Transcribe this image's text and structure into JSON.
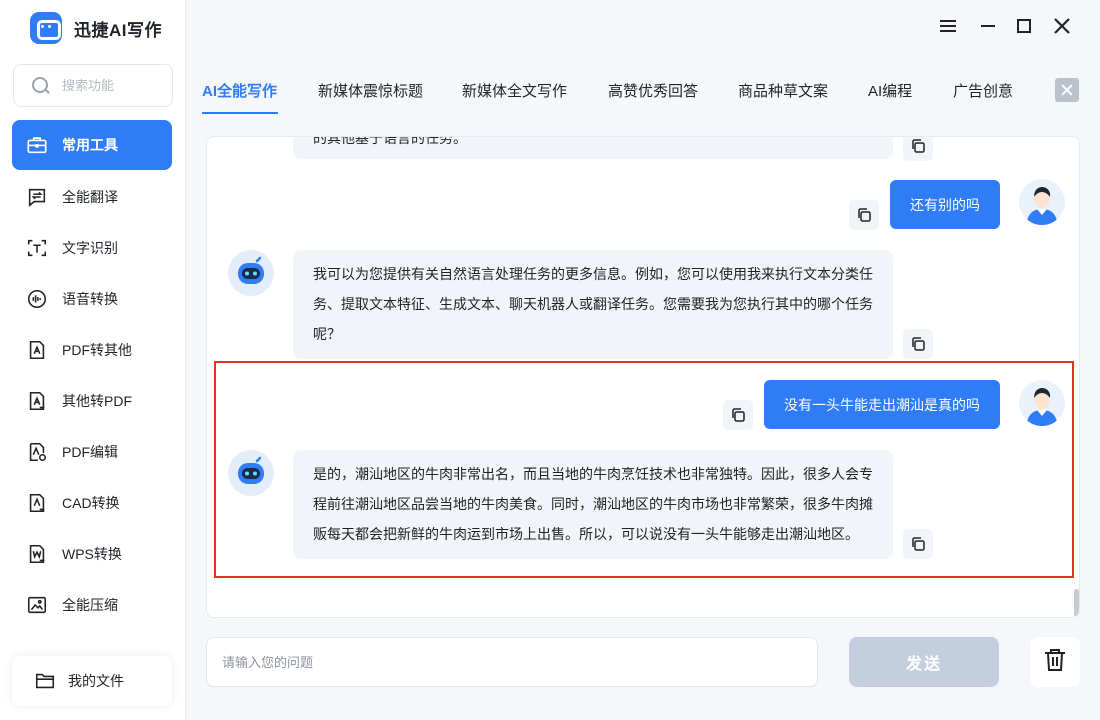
{
  "app": {
    "title": "迅捷AI写作"
  },
  "search": {
    "placeholder": "搜索功能"
  },
  "sidebar": {
    "items": [
      {
        "label": "常用工具",
        "icon": "toolbox-icon",
        "active": true
      },
      {
        "label": "全能翻译",
        "icon": "translate-icon"
      },
      {
        "label": "文字识别",
        "icon": "text-recognition-icon"
      },
      {
        "label": "语音转换",
        "icon": "voice-convert-icon"
      },
      {
        "label": "PDF转其他",
        "icon": "pdf-convert-icon"
      },
      {
        "label": "其他转PDF",
        "icon": "to-pdf-icon"
      },
      {
        "label": "PDF编辑",
        "icon": "pdf-edit-icon"
      },
      {
        "label": "CAD转换",
        "icon": "cad-convert-icon"
      },
      {
        "label": "WPS转换",
        "icon": "wps-convert-icon"
      },
      {
        "label": "全能压缩",
        "icon": "compress-icon"
      }
    ],
    "my_files": "我的文件"
  },
  "tabs": [
    "AI全能写作",
    "新媒体震惊标题",
    "新媒体全文写作",
    "高赞优秀回答",
    "商品种草文案",
    "AI编程",
    "广告创意"
  ],
  "chat": {
    "partial_text": "的其他基于语言的任务。",
    "messages": [
      {
        "role": "user",
        "text": "还有别的吗"
      },
      {
        "role": "ai",
        "lines": [
          "我可以为您提供有关自然语言处理任务的更多信息。例如，您可以使用我来执行文本分类任",
          "务、提取文本特征、生成文本、聊天机器人或翻译任务。您需要我为您执行其中的哪个任务",
          "呢？"
        ]
      },
      {
        "role": "user",
        "text": "没有一头牛能走出潮汕是真的吗"
      },
      {
        "role": "ai",
        "lines": [
          "是的，潮汕地区的牛肉非常出名，而且当地的牛肉烹饪技术也非常独特。因此，很多人会专",
          "程前往潮汕地区品尝当地的牛肉美食。同时，潮汕地区的牛肉市场也非常繁荣，很多牛肉摊",
          "贩每天都会把新鲜的牛肉运到市场上出售。所以，可以说没有一头牛能够走出潮汕地区。"
        ]
      }
    ]
  },
  "composer": {
    "placeholder": "请输入您的问题",
    "send_label": "发送"
  },
  "colors": {
    "accent": "#2f7cf6",
    "highlight": "#e5321f",
    "send_disabled": "#c3cfdf"
  }
}
